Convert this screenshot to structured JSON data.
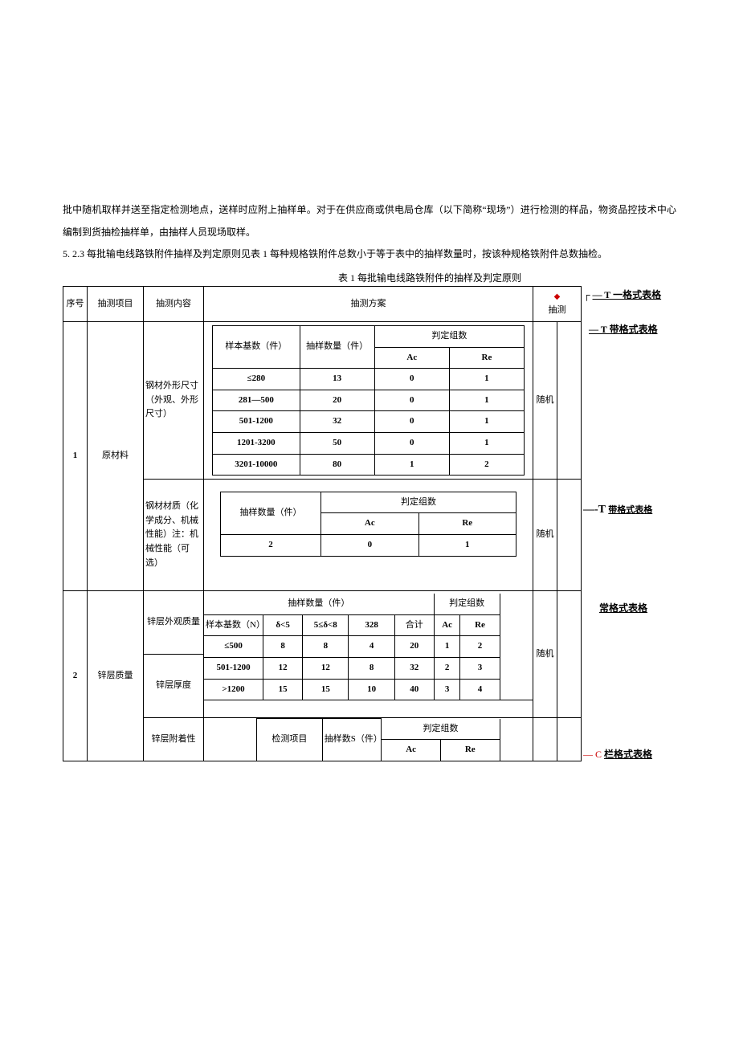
{
  "paragraphs": {
    "p1": "批中随机取样并送至指定检测地点，送样时应附上抽样单。对于在供应商或供电局仓库（以下简称“现场”）进行检测的样品，物资品控技术中心编制到货抽检抽样单，由抽样人员现场取样。",
    "p2": "5.  2.3 每批输电线路铁附件抽样及判定原则见表 1 每种规格铁附件总数小于等于表中的抽样数量时，按该种规格铁附件总数抽检。",
    "caption": "表 1 每批输电线路铁附件的抽样及判定原则"
  },
  "headers": {
    "seq": "序号",
    "proj": "抽测项目",
    "content": "抽测内容",
    "plan": "抽测方案",
    "sample": "抽测",
    "sample_base": "样本基数（件）",
    "sample_qty": "抽样数量（件）",
    "judge": "判定组数",
    "sample_base_n": "样本基数（N）",
    "ac": "Ac",
    "re": "Re",
    "rand": "随机",
    "total": "合计",
    "d5": "δ<5",
    "d58": "5≤δ<8",
    "d328": "328",
    "test_item": "检测项目",
    "sample_s": "抽样数S（件）"
  },
  "rows": {
    "r1": {
      "seq": "1",
      "proj": "原材料",
      "c1": "钢材外形尺寸（外观、外形尺寸）",
      "c2": "钢材材质（化学成分、机械性能）注：机械性能（可选）",
      "t1": [
        {
          "base": "≤280",
          "qty": "13",
          "ac": "0",
          "re": "1"
        },
        {
          "base": "281—500",
          "qty": "20",
          "ac": "0",
          "re": "1"
        },
        {
          "base": "501-1200",
          "qty": "32",
          "ac": "0",
          "re": "1"
        },
        {
          "base": "1201-3200",
          "qty": "50",
          "ac": "0",
          "re": "1"
        },
        {
          "base": "3201-10000",
          "qty": "80",
          "ac": "1",
          "re": "2"
        }
      ],
      "t2": {
        "qty": "2",
        "ac": "0",
        "re": "1"
      }
    },
    "r2": {
      "seq": "2",
      "proj": "锌层质量",
      "c1": "锌层外观质量",
      "c2": "锌层厚度",
      "c3": "锌层附着性",
      "t1": [
        {
          "n": "≤500",
          "a": "8",
          "b": "8",
          "c": "4",
          "sum": "20",
          "ac": "1",
          "re": "2"
        },
        {
          "n": "501-1200",
          "a": "12",
          "b": "12",
          "c": "8",
          "sum": "32",
          "ac": "2",
          "re": "3"
        },
        {
          "n": ">1200",
          "a": "15",
          "b": "15",
          "c": "10",
          "sum": "40",
          "ac": "3",
          "re": "4"
        }
      ]
    }
  },
  "annotations": {
    "a1": "— T 一格式表格",
    "a2": "— T 带格式表格",
    "a3p": "—-T ",
    "a3": "带格式表格",
    "a4": "常格式表格",
    "a5p": "— C ",
    "a5": "栏格式表格"
  }
}
